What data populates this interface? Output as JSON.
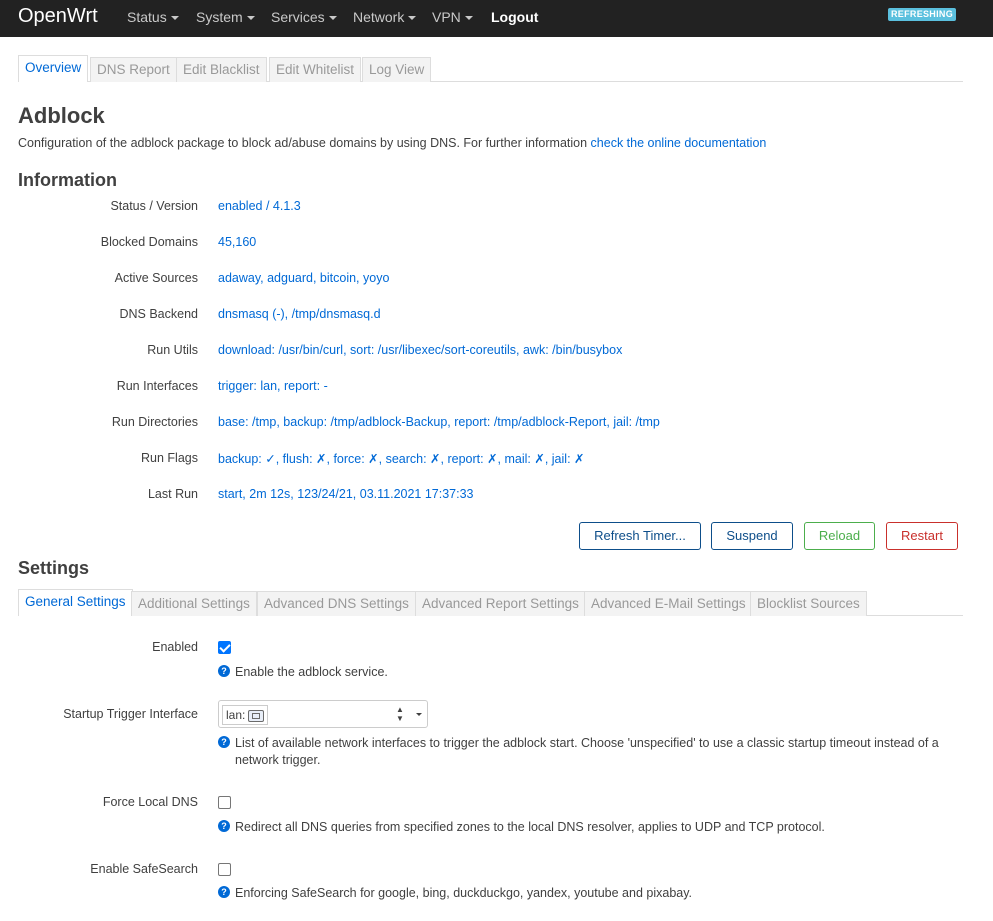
{
  "brand": "OpenWrt",
  "nav": {
    "status": "Status",
    "system": "System",
    "services": "Services",
    "network": "Network",
    "vpn": "VPN",
    "logout": "Logout"
  },
  "refreshing_badge": "REFRESHING",
  "top_tabs": [
    "Overview",
    "DNS Report",
    "Edit Blacklist",
    "Edit Whitelist",
    "Log View"
  ],
  "page": {
    "title": "Adblock",
    "description": "Configuration of the adblock package to block ad/abuse domains by using DNS. For further information ",
    "doc_link": "check the online documentation"
  },
  "information": {
    "heading": "Information",
    "rows": [
      {
        "label": "Status / Version",
        "value": "enabled / 4.1.3"
      },
      {
        "label": "Blocked Domains",
        "value": "45,160"
      },
      {
        "label": "Active Sources",
        "value": "adaway, adguard, bitcoin, yoyo"
      },
      {
        "label": "DNS Backend",
        "value": "dnsmasq (-), /tmp/dnsmasq.d"
      },
      {
        "label": "Run Utils",
        "value": "download: /usr/bin/curl, sort: /usr/libexec/sort-coreutils, awk: /bin/busybox"
      },
      {
        "label": "Run Interfaces",
        "value": "trigger: lan, report: -"
      },
      {
        "label": "Run Directories",
        "value": "base: /tmp, backup: /tmp/adblock-Backup, report: /tmp/adblock-Report, jail: /tmp"
      },
      {
        "label": "Run Flags",
        "value": "backup: ✓, flush: ✗, force: ✗, search: ✗, report: ✗, mail: ✗, jail: ✗"
      },
      {
        "label": "Last Run",
        "value": "start, 2m 12s, 123/24/21, 03.11.2021 17:37:33"
      }
    ]
  },
  "actions": {
    "refresh_timer": "Refresh Timer...",
    "suspend": "Suspend",
    "reload": "Reload",
    "restart": "Restart"
  },
  "settings": {
    "heading": "Settings",
    "tabs": [
      "General Settings",
      "Additional Settings",
      "Advanced DNS Settings",
      "Advanced Report Settings",
      "Advanced E-Mail Settings",
      "Blocklist Sources"
    ],
    "enabled": {
      "label": "Enabled",
      "checked": true,
      "help": "Enable the adblock service."
    },
    "trigger": {
      "label": "Startup Trigger Interface",
      "value": "lan:",
      "help": "List of available network interfaces to trigger the adblock start. Choose 'unspecified' to use a classic startup timeout instead of a network trigger."
    },
    "force_dns": {
      "label": "Force Local DNS",
      "checked": false,
      "help": "Redirect all DNS queries from specified zones to the local DNS resolver, applies to UDP and TCP protocol."
    },
    "safesearch": {
      "label": "Enable SafeSearch",
      "checked": false,
      "help": "Enforcing SafeSearch for google, bing, duckduckgo, yandex, youtube and pixabay."
    }
  },
  "colors": {
    "topbar": "#222222",
    "link": "#0069d6",
    "reload": "#4cae4c",
    "restart": "#c9302c"
  }
}
